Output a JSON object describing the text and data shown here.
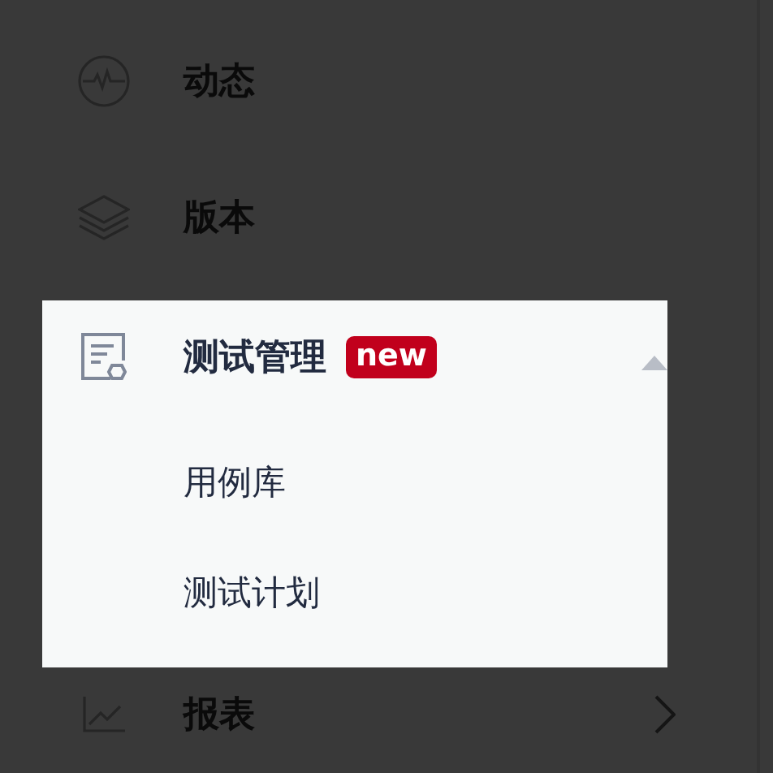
{
  "menu": {
    "items": [
      {
        "label": "动态",
        "kind": "leaf",
        "spotlight": false
      },
      {
        "label": "版本",
        "kind": "leaf",
        "spotlight": false
      },
      {
        "label": "测试管理",
        "kind": "group",
        "badge": "new",
        "expanded": true,
        "spotlight": true,
        "children": [
          {
            "label": "用例库"
          },
          {
            "label": "测试计划"
          }
        ]
      },
      {
        "label": "报表",
        "kind": "group",
        "expanded": false,
        "spotlight": false
      }
    ]
  }
}
